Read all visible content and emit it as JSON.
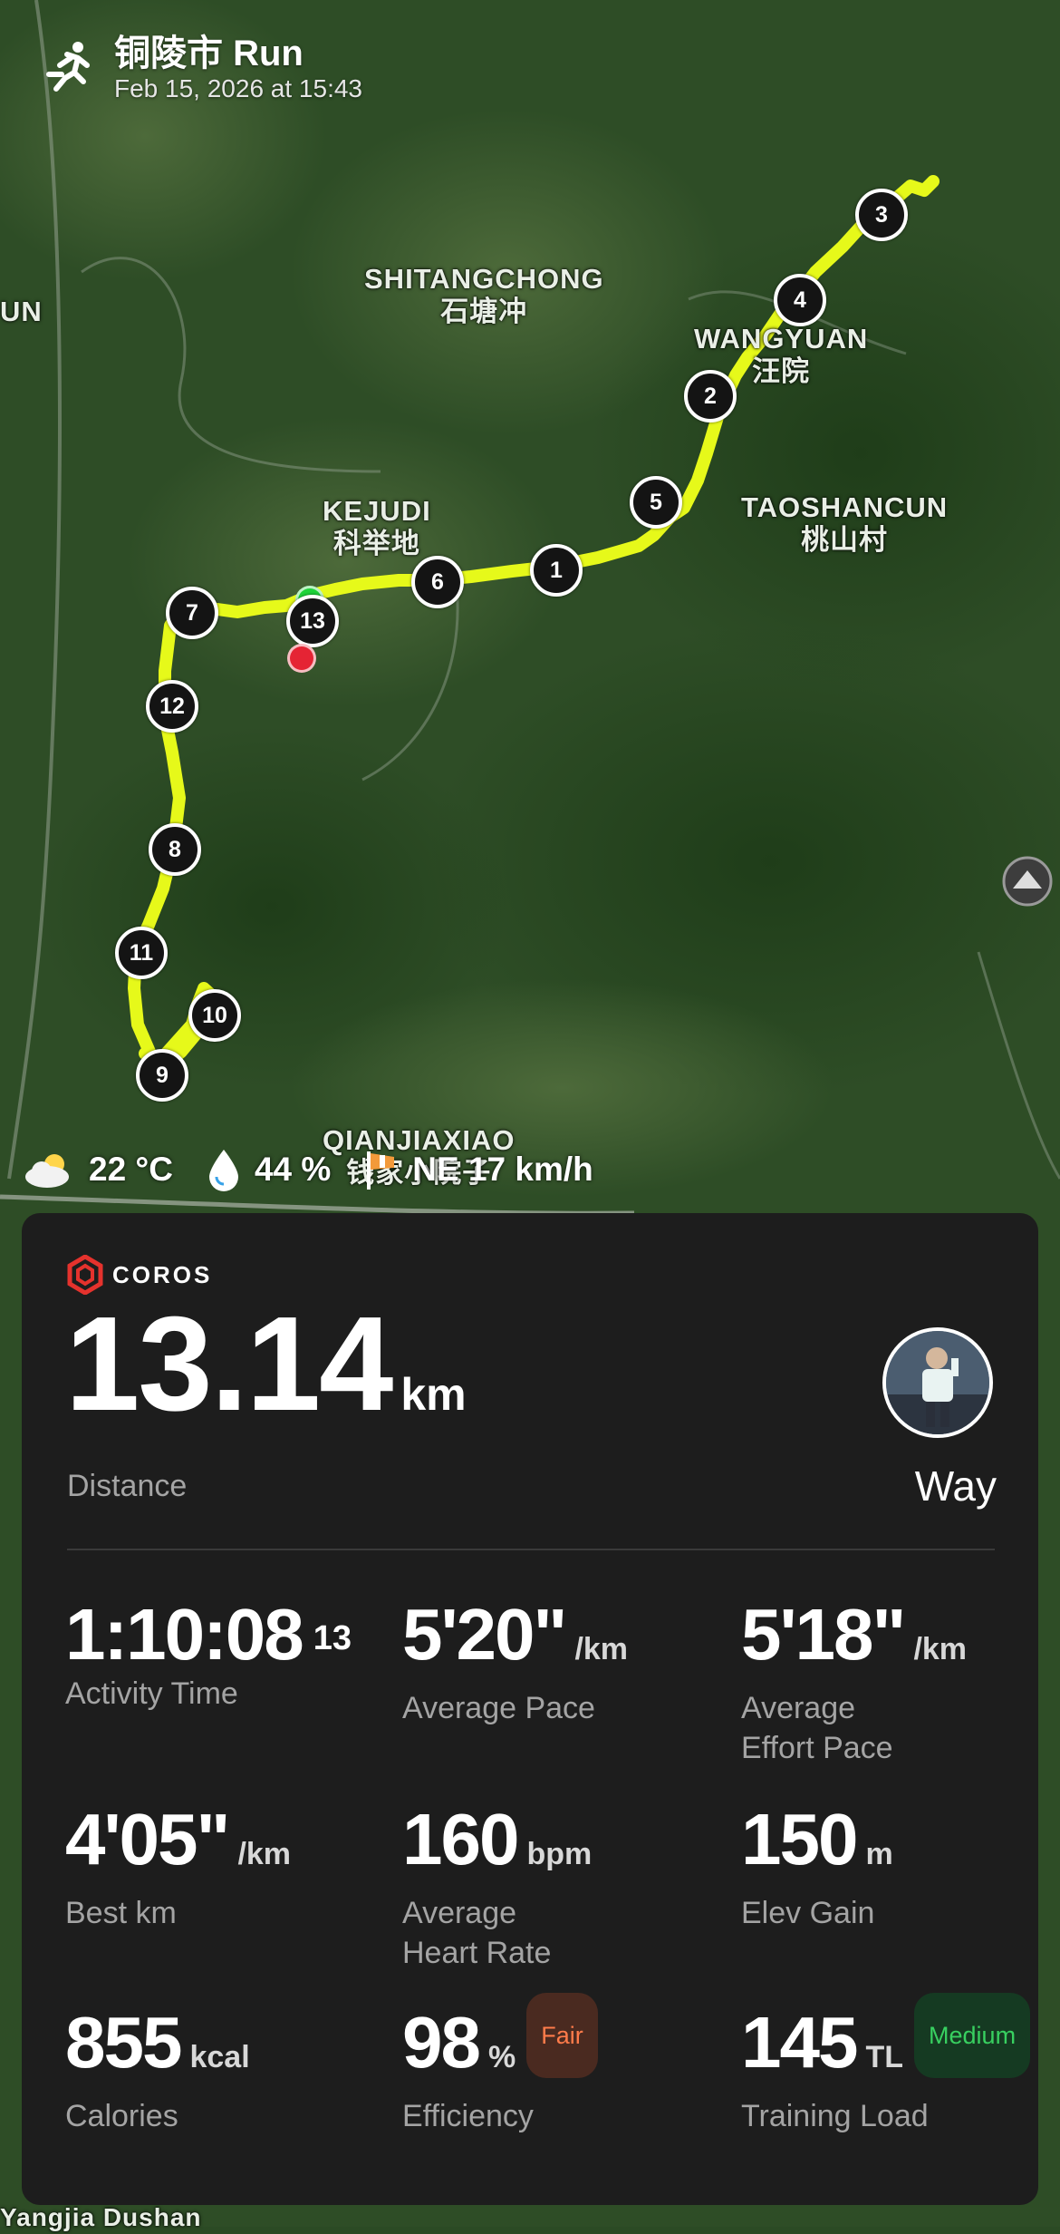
{
  "header": {
    "title": "铜陵市 Run",
    "subtitle": "Feb 15, 2026 at 15:43",
    "icon": "running-person-icon"
  },
  "map": {
    "labels": [
      {
        "en": "SHITANGCHONG",
        "zh": "石塘冲"
      },
      {
        "en": "WANGYUAN",
        "zh": "汪院"
      },
      {
        "en": "KEJUDI",
        "zh": "科举地"
      },
      {
        "en": "TAOSHANCUN",
        "zh": "桃山村"
      },
      {
        "en": "QIANJIAXIAO",
        "zh": "钱家小院子"
      }
    ],
    "edge_labels": [
      "UN",
      "Yangjia Dushan"
    ],
    "km_markers": [
      "1",
      "2",
      "3",
      "4",
      "5",
      "6",
      "7",
      "8",
      "9",
      "10",
      "11",
      "12",
      "13"
    ],
    "route_color": "#e6f91a",
    "start_color": "#1ed43a",
    "end_color": "#e52434"
  },
  "weather": {
    "temperature": "22 °C",
    "humidity": "44 %",
    "wind": "NE 17 km/h",
    "icons": [
      "partly-cloudy-icon",
      "humidity-drop-icon",
      "wind-flag-icon"
    ]
  },
  "card": {
    "brand": "COROS",
    "distance": {
      "value": "13.14",
      "unit": "km",
      "label": "Distance"
    },
    "user": {
      "name": "Way"
    },
    "stats": [
      {
        "value": "1:10:08",
        "sup": "13",
        "unit": "",
        "label": "Activity Time"
      },
      {
        "value": "5'20\"",
        "unit": "/km",
        "label": "Average Pace"
      },
      {
        "value": "5'18\"",
        "unit": "/km",
        "label": "Average\nEffort Pace"
      },
      {
        "value": "4'05\"",
        "unit": "/km",
        "label": "Best km"
      },
      {
        "value": "160",
        "unit": "bpm",
        "label": "Average\nHeart Rate"
      },
      {
        "value": "150",
        "unit": "m",
        "label": "Elev Gain"
      },
      {
        "value": "855",
        "unit": "kcal",
        "label": "Calories"
      },
      {
        "value": "98",
        "unit": "%",
        "badge": "Fair",
        "label": "Efficiency"
      },
      {
        "value": "145",
        "unit": "TL",
        "badge": "Medium",
        "label": "Training Load"
      }
    ]
  }
}
